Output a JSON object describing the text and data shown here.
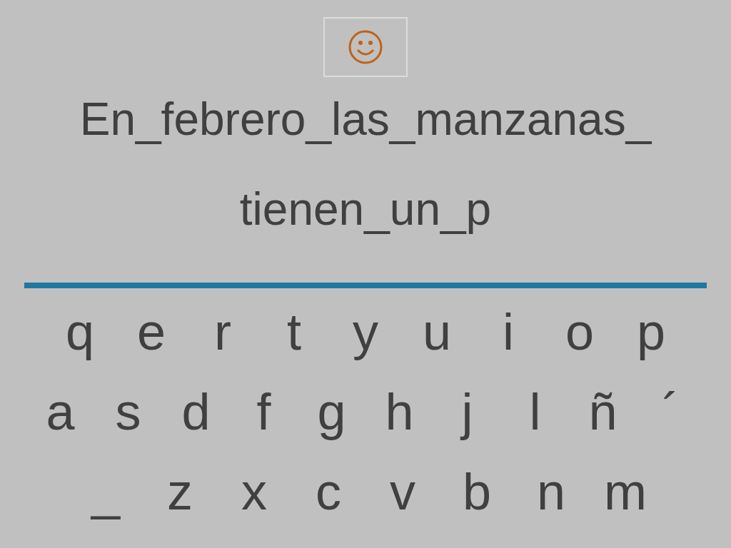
{
  "sentence_lines": [
    "En_febrero_las_manzanas_",
    "tienen_un_p"
  ],
  "keyboard_rows": [
    [
      "q",
      "e",
      "r",
      "t",
      "y",
      "u",
      "i",
      "o",
      "p"
    ],
    [
      "a",
      "s",
      "d",
      "f",
      "g",
      "h",
      "j",
      "l",
      "ñ",
      "´"
    ],
    [
      "_",
      "z",
      "x",
      "c",
      "v",
      "b",
      "n",
      "m"
    ]
  ]
}
